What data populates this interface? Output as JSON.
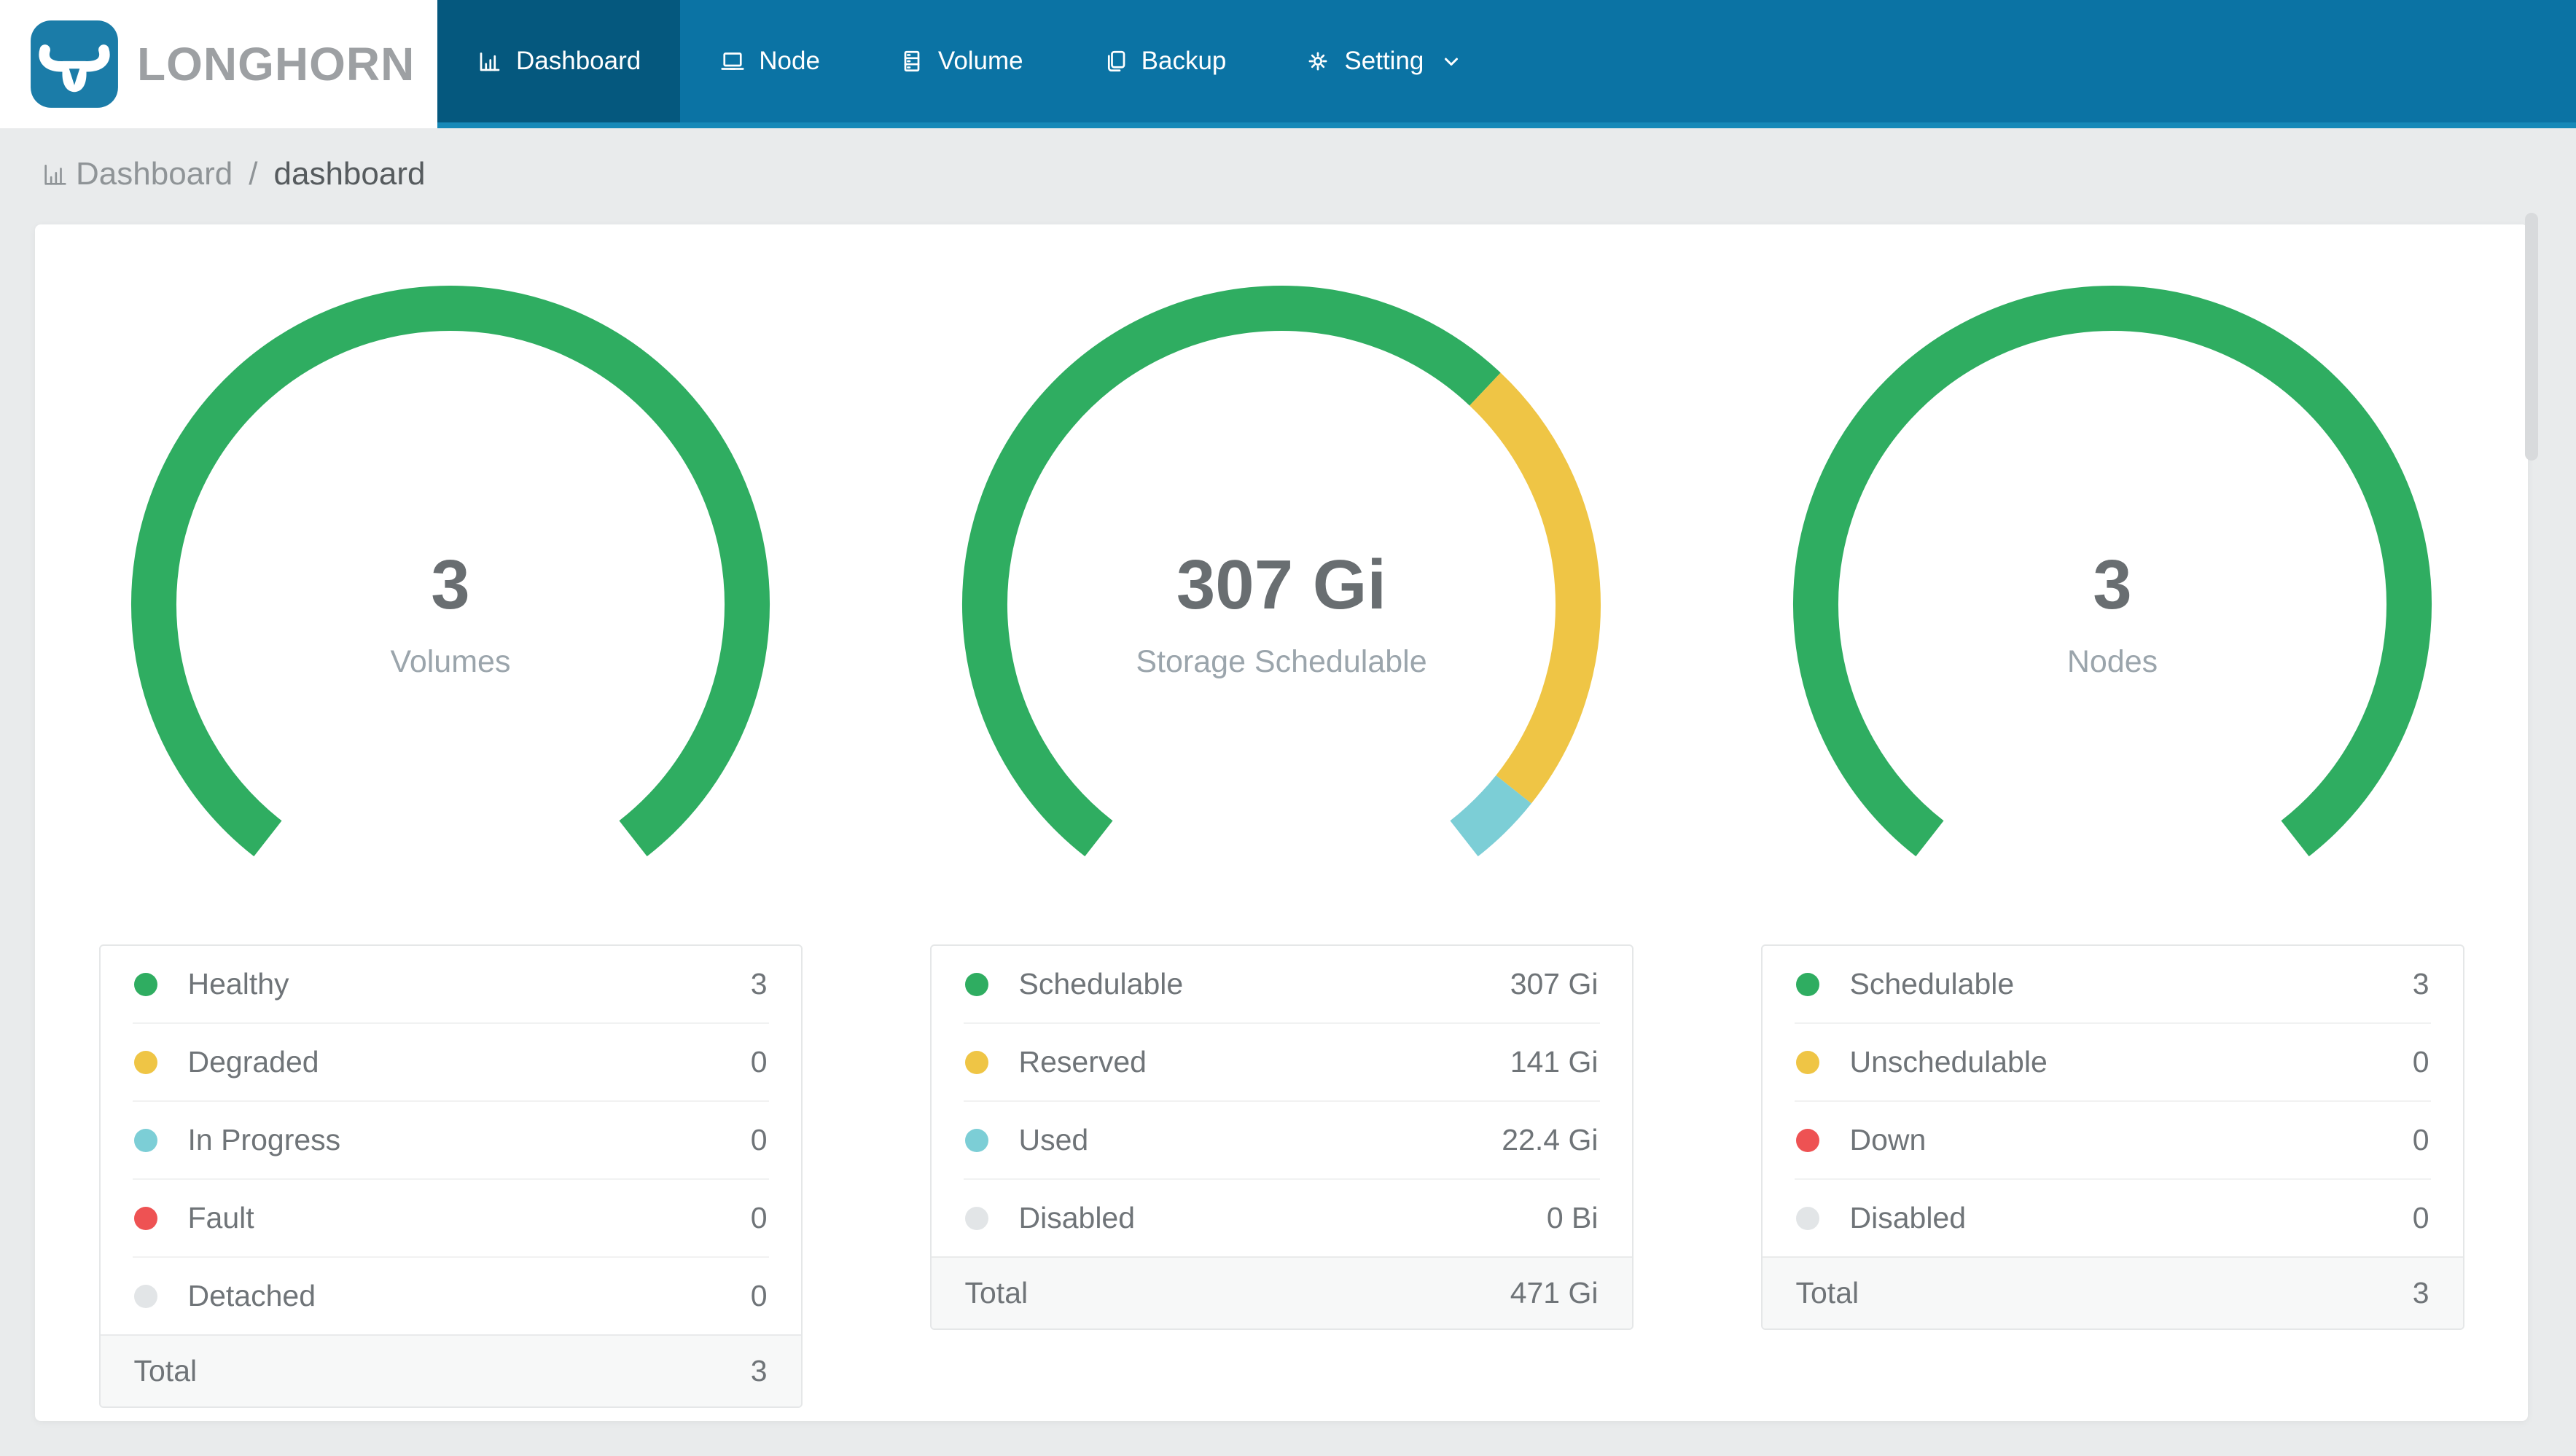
{
  "colors": {
    "green": "#2FAD61",
    "yellow": "#EFC545",
    "teal": "#7CCED6",
    "red": "#EE5253",
    "gray": "#E2E5E7",
    "nav_bg": "#0B73A4",
    "nav_active_bg": "#05587E",
    "nav_underline": "#1689B8",
    "logo_bg": "#1B7CA8",
    "brand_text_color": "#9DA0A3",
    "page_bg": "#E9EBEC",
    "center_number_color": "#696E71",
    "center_label_color": "#9BA5AC",
    "legend_text_color": "#6F7478"
  },
  "header": {
    "brand": "LONGHORN",
    "nav": {
      "items": [
        {
          "label": "Dashboard",
          "icon": "bar-chart-icon",
          "active": true
        },
        {
          "label": "Node",
          "icon": "node-icon",
          "active": false
        },
        {
          "label": "Volume",
          "icon": "volume-icon",
          "active": false
        },
        {
          "label": "Backup",
          "icon": "backup-icon",
          "active": false
        },
        {
          "label": "Setting",
          "icon": "gear-icon",
          "active": false,
          "has_dropdown": true
        }
      ]
    }
  },
  "breadcrumb": {
    "icon": "bar-chart-icon",
    "section": "Dashboard",
    "separator": "/",
    "current": "dashboard"
  },
  "chart_data": [
    {
      "type": "pie",
      "variant": "gauge-donut",
      "title": "Volumes",
      "center_value": "3",
      "center_label": "Volumes",
      "arc": {
        "start_deg": 218,
        "sweep_deg": 284,
        "stroke_width": 62,
        "radius": 407
      },
      "segments": [
        {
          "label": "Healthy",
          "value": 3,
          "display": "3",
          "color": "green"
        },
        {
          "label": "Degraded",
          "value": 0,
          "display": "0",
          "color": "yellow"
        },
        {
          "label": "In Progress",
          "value": 0,
          "display": "0",
          "color": "teal"
        },
        {
          "label": "Fault",
          "value": 0,
          "display": "0",
          "color": "red"
        },
        {
          "label": "Detached",
          "value": 0,
          "display": "0",
          "color": "gray"
        }
      ],
      "total": {
        "label": "Total",
        "display": "3"
      }
    },
    {
      "type": "pie",
      "variant": "gauge-donut",
      "title": "Storage Schedulable",
      "center_value": "307 Gi",
      "center_label": "Storage Schedulable",
      "arc": {
        "start_deg": 218,
        "sweep_deg": 284,
        "stroke_width": 62,
        "radius": 407
      },
      "segments": [
        {
          "label": "Schedulable",
          "value": 307,
          "display": "307 Gi",
          "color": "green"
        },
        {
          "label": "Reserved",
          "value": 141,
          "display": "141 Gi",
          "color": "yellow"
        },
        {
          "label": "Used",
          "value": 22.4,
          "display": "22.4 Gi",
          "color": "teal"
        },
        {
          "label": "Disabled",
          "value": 0,
          "display": "0 Bi",
          "color": "gray"
        }
      ],
      "total": {
        "label": "Total",
        "display": "471 Gi"
      }
    },
    {
      "type": "pie",
      "variant": "gauge-donut",
      "title": "Nodes",
      "center_value": "3",
      "center_label": "Nodes",
      "arc": {
        "start_deg": 218,
        "sweep_deg": 284,
        "stroke_width": 62,
        "radius": 407
      },
      "segments": [
        {
          "label": "Schedulable",
          "value": 3,
          "display": "3",
          "color": "green"
        },
        {
          "label": "Unschedulable",
          "value": 0,
          "display": "0",
          "color": "yellow"
        },
        {
          "label": "Down",
          "value": 0,
          "display": "0",
          "color": "red"
        },
        {
          "label": "Disabled",
          "value": 0,
          "display": "0",
          "color": "gray"
        }
      ],
      "total": {
        "label": "Total",
        "display": "3"
      }
    }
  ]
}
